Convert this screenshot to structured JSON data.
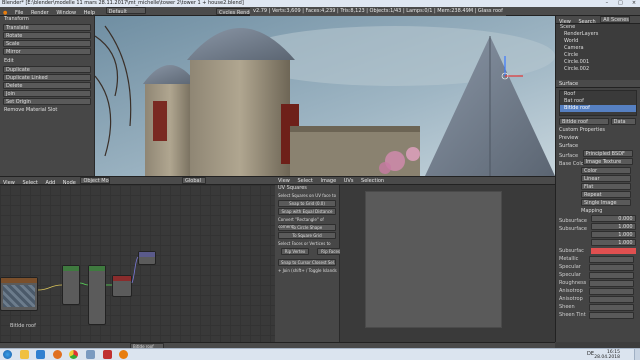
{
  "window": {
    "title": "Blender* [E:\\blender\\modelle 11 mars 28.11.2017\\mt_michelle\\tower 2\\tower 1 + house2.blend]",
    "controls": [
      "–",
      "□",
      "×"
    ]
  },
  "menubar": {
    "items": [
      "File",
      "Render",
      "Window",
      "Help"
    ],
    "layout_value": "Default",
    "engine": "Cycles Render",
    "stats": "v2.79 | Verts:3,609 | Faces:4,239 | Tris:8,123 | Objects:1/43 | Lamps:0/1 | Mem:238.49M | Glass roof"
  },
  "tools": {
    "transform_header": "Transform",
    "transform_buttons": [
      "Translate",
      "Rotate",
      "Scale",
      "Mirror"
    ],
    "edit_header": "Edit",
    "edit_buttons": [
      "Duplicate",
      "Duplicate Linked",
      "Delete",
      "Join",
      "Set Origin"
    ],
    "history_header": "Remove Material Slot"
  },
  "outliner": {
    "search_label": "View",
    "search_label2": "Search",
    "scene_select": "All Scenes",
    "rows": [
      "Scene",
      "RenderLayers",
      "World",
      "Camera",
      "Circle",
      "Circle.001",
      "Circle.002"
    ]
  },
  "properties": {
    "tabs_label": "Surface",
    "material_slots": [
      "Roof",
      "Bat roof",
      "Bitlde roof"
    ],
    "material_name": "Bitlde roof",
    "data_label": "Data",
    "sections": [
      "Custom Properties",
      "Preview",
      "Surface"
    ],
    "surface_value": "Principled BSDF",
    "base_color_label": "Base Color",
    "base_color_value": "Image Texture",
    "image_options": [
      "Color",
      "Linear",
      "Flat",
      "Repeat",
      "Single Image"
    ],
    "mapping_label": "Mapping",
    "params": [
      {
        "label": "Subsurface",
        "value": "0.000"
      },
      {
        "label": "Subsurface",
        "value": "1.000"
      },
      {
        "label": "",
        "value": "1.000"
      },
      {
        "label": "",
        "value": "1.000"
      }
    ],
    "params2": [
      "Subsurfac",
      "Metallic",
      "Specular",
      "Specular",
      "Roughness",
      "Anisotrop",
      "Anisotrop",
      "Sheen",
      "Sheen Tint"
    ]
  },
  "node_editor": {
    "menu": [
      "View",
      "Select",
      "Add",
      "Node"
    ],
    "mode": "Object Mode",
    "object_label": "Bitlde roof",
    "material_name": "Bitlde roof",
    "status_label": "Bitlde roof",
    "view_button": "Global"
  },
  "uv_tools": {
    "title": "Selection",
    "section1": "UV Squares",
    "section1_sub": "Select Squares on UV face to",
    "buttons1": [
      "Snap to Grid (0.0)",
      "Snap with Equal Distance"
    ],
    "section2": "Convert \"Rectangle\" of corners",
    "buttons2": [
      "To Circle Shape",
      "To Square Grid"
    ],
    "section3": "Select Faces or Vertices to",
    "buttons3": [
      "Rip Vertex",
      "Rip Faces",
      "Snap to Cursor Closest Sel."
    ],
    "hint": "+ Join (shift+ / Toggle Islands"
  },
  "uv_editor": {
    "menu": [
      "View",
      "Select",
      "Image",
      "UVs"
    ]
  },
  "taskbar": {
    "time": "16:15",
    "date": "28.04.2018",
    "lang": "DE"
  },
  "colors": {
    "accent": "#5680c2",
    "panel": "#474747",
    "titlebar": "#dfe7f2",
    "taskbar": "#dbe4ef"
  }
}
